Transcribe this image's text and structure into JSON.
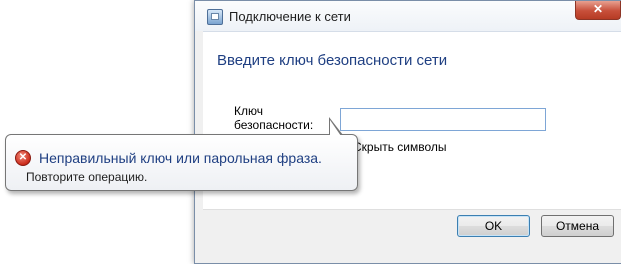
{
  "window": {
    "title": "Подключение к сети",
    "close_symbol": "✕",
    "heading": "Введите ключ безопасности сети"
  },
  "form": {
    "key_label_line1": "Ключ",
    "key_label_line2": "безопасности:",
    "key_value": "",
    "hide_symbols_label": "Скрыть символы"
  },
  "buttons": {
    "ok": "OK",
    "cancel": "Отмена"
  },
  "error_balloon": {
    "icon": "error-icon",
    "icon_symbol": "✕",
    "title": "Неправильный ключ или парольная фраза.",
    "message": "Повторите операцию."
  }
}
